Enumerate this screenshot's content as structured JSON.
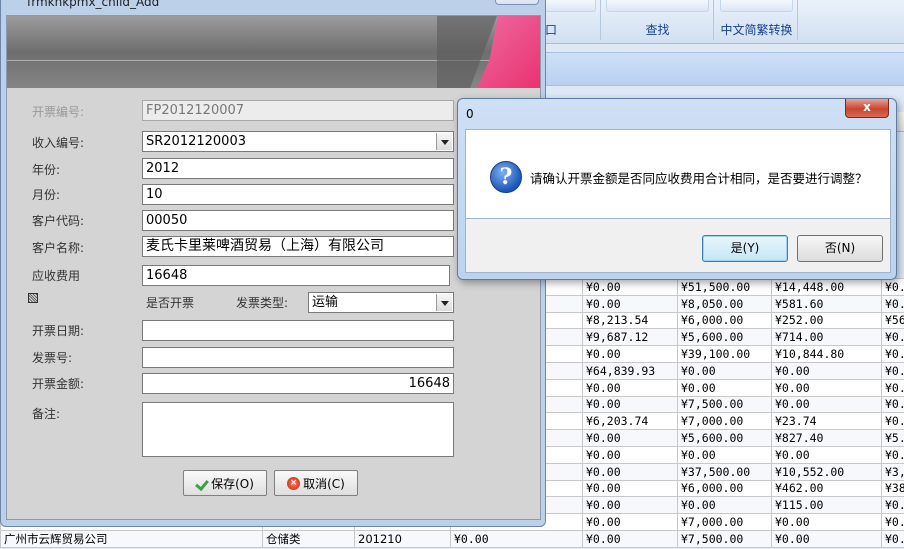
{
  "background_app": {
    "ribbon_groups": [
      {
        "label": "口"
      },
      {
        "label": "查找"
      },
      {
        "label": "中文简繁转换"
      }
    ],
    "grid_rows": [
      [
        "",
        "",
        "",
        "",
        "¥0.00",
        "¥51,500.00",
        "¥14,448.00",
        "¥0."
      ],
      [
        "",
        "",
        "",
        "",
        "¥0.00",
        "¥8,050.00",
        "¥581.60",
        "¥0."
      ],
      [
        "",
        "",
        "",
        "",
        "¥8,213.54",
        "¥6,000.00",
        "¥252.00",
        "¥56"
      ],
      [
        "",
        "",
        "",
        "",
        "¥9,687.12",
        "¥5,600.00",
        "¥714.00",
        "¥0."
      ],
      [
        "",
        "",
        "",
        "",
        "¥0.00",
        "¥39,100.00",
        "¥10,844.80",
        "¥0."
      ],
      [
        "",
        "",
        "",
        "",
        "¥64,839.93",
        "¥0.00",
        "¥0.00",
        "¥0."
      ],
      [
        "",
        "",
        "",
        "",
        "¥0.00",
        "¥0.00",
        "¥0.00",
        "¥0."
      ],
      [
        "",
        "",
        "",
        "",
        "¥0.00",
        "¥7,500.00",
        "¥0.00",
        "¥0."
      ],
      [
        "",
        "",
        "",
        "",
        "¥6,203.74",
        "¥7,000.00",
        "¥23.74",
        "¥0."
      ],
      [
        "",
        "",
        "",
        "",
        "¥0.00",
        "¥5,600.00",
        "¥827.40",
        "¥5."
      ],
      [
        "",
        "",
        "",
        "",
        "¥0.00",
        "¥0.00",
        "¥0.00",
        "¥0."
      ],
      [
        "",
        "",
        "",
        "",
        "¥0.00",
        "¥37,500.00",
        "¥10,552.00",
        "¥3,"
      ],
      [
        "",
        "",
        "",
        "",
        "¥0.00",
        "¥6,000.00",
        "¥462.00",
        "¥38"
      ],
      [
        "",
        "",
        "",
        "",
        "¥0.00",
        "¥0.00",
        "¥115.00",
        "¥0."
      ],
      [
        "",
        "",
        "",
        "",
        "¥0.00",
        "¥7,000.00",
        "¥0.00",
        "¥0."
      ],
      [
        "广州市云辉贸易公司",
        "仓储类",
        "201210",
        "¥0.00",
        "¥0.00",
        "¥7,500.00",
        "¥0.00",
        "¥0."
      ]
    ]
  },
  "form": {
    "title": "frmkhkpmx_child_Add",
    "fields": {
      "invoice_no": {
        "label": "开票编号:",
        "value": "FP2012120007"
      },
      "income_no": {
        "label": "收入编号:",
        "value": "SR2012120003"
      },
      "year": {
        "label": "年份:",
        "value": "2012"
      },
      "month": {
        "label": "月份:",
        "value": "10"
      },
      "customer_code": {
        "label": "客户代码:",
        "value": "00050"
      },
      "customer_name": {
        "label": "客户名称:",
        "value": "麦氏卡里莱啤酒贸易（上海）有限公司"
      },
      "receivable": {
        "label": "应收费用",
        "value": "16648"
      },
      "is_invoiced": {
        "label": "是否开票"
      },
      "invoice_type": {
        "label": "发票类型:",
        "value": "运输"
      },
      "invoice_date": {
        "label": "开票日期:",
        "value": ""
      },
      "receipt_no": {
        "label": "发票号:",
        "value": ""
      },
      "invoice_amount": {
        "label": "开票金额:",
        "value": "16648"
      },
      "remark": {
        "label": "备注:",
        "value": ""
      }
    },
    "save_label": "保存(O)",
    "cancel_label": "取消(C)"
  },
  "dialog": {
    "title": "0",
    "close_label": "x",
    "message": "请确认开票金额是否同应收费用合计相同，是否要进行调整？",
    "yes_label": "是(Y)",
    "no_label": "否(N)"
  }
}
